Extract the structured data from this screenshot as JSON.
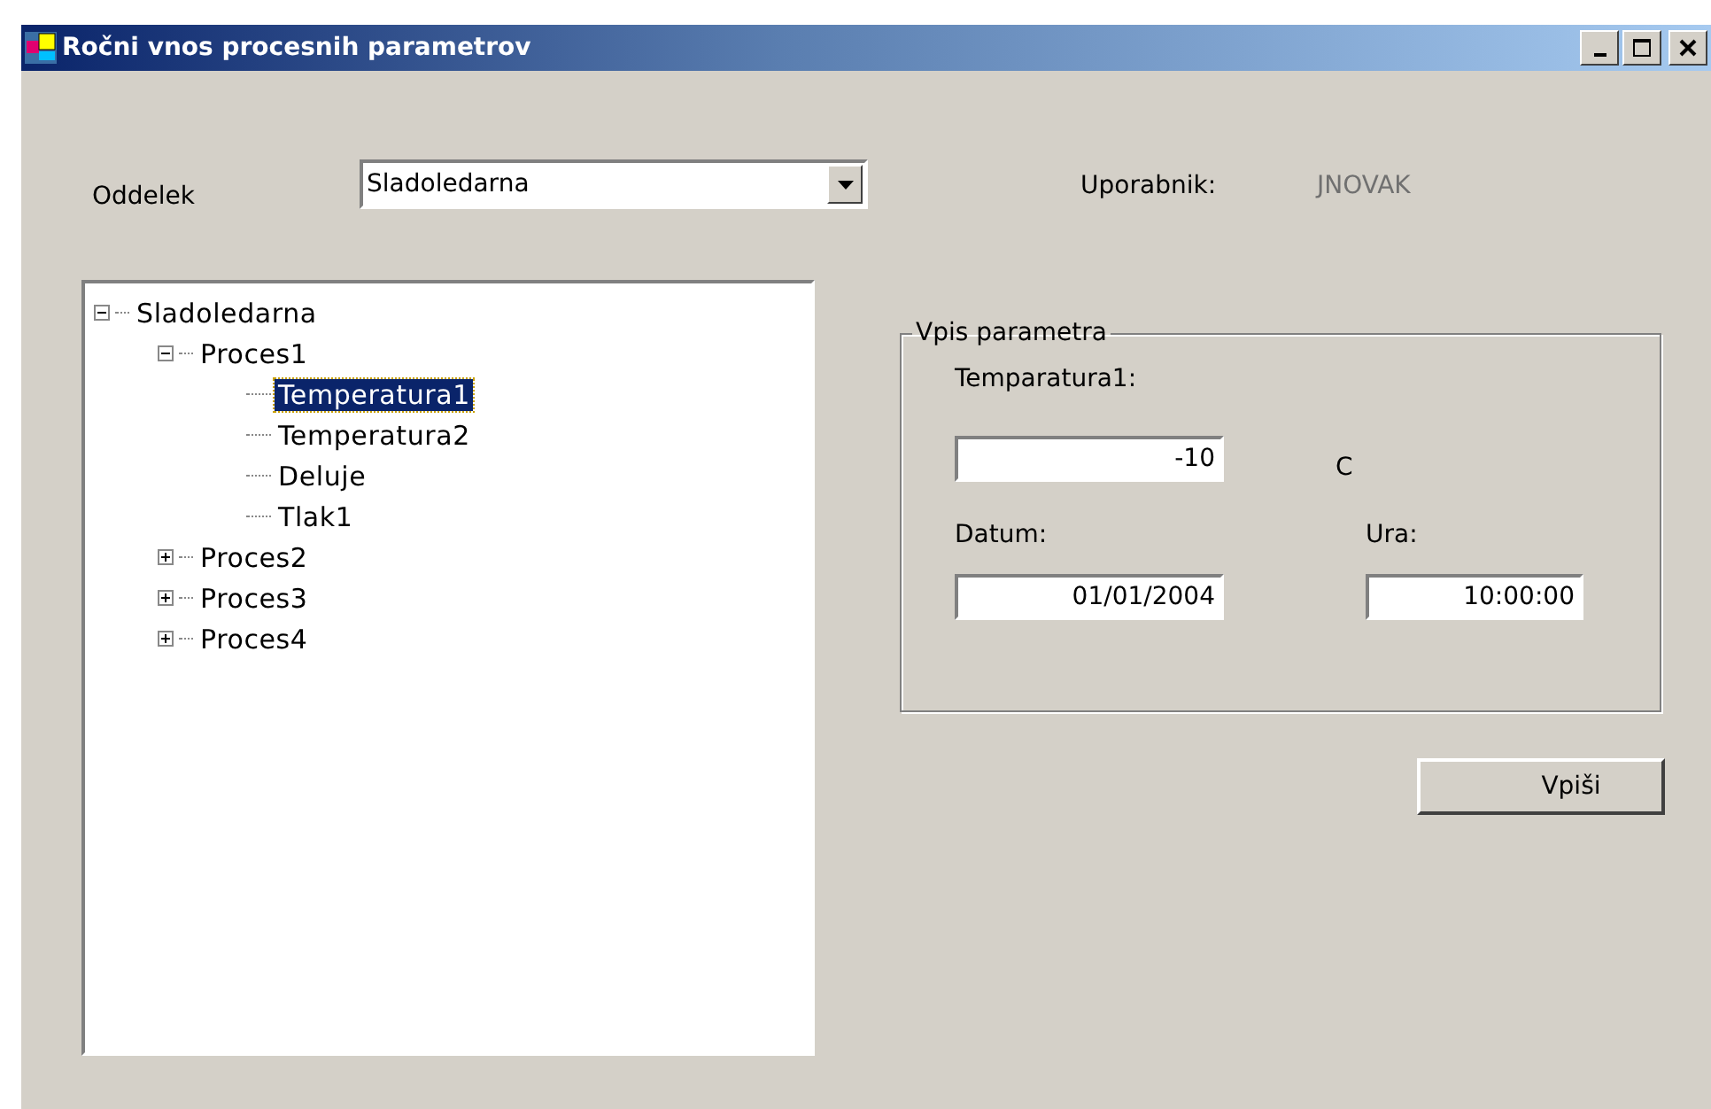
{
  "window": {
    "title": "Ročni vnos procesnih parametrov"
  },
  "department": {
    "label": "Oddelek",
    "value": "Sladoledarna"
  },
  "user": {
    "label": "Uporabnik:",
    "value": "JNOVAK"
  },
  "tree": [
    {
      "label": "Sladoledarna",
      "expanded": true,
      "selected": false,
      "children": [
        {
          "label": "Proces1",
          "expanded": true,
          "selected": false,
          "children": [
            {
              "label": "Temperatura1",
              "selected": true
            },
            {
              "label": "Temperatura2",
              "selected": false
            },
            {
              "label": "Deluje",
              "selected": false
            },
            {
              "label": "Tlak1",
              "selected": false
            }
          ]
        },
        {
          "label": "Proces2",
          "expanded": false,
          "selected": false
        },
        {
          "label": "Proces3",
          "expanded": false,
          "selected": false
        },
        {
          "label": "Proces4",
          "expanded": false,
          "selected": false
        }
      ]
    }
  ],
  "group": {
    "title": "Vpis parametra",
    "param_label": "Temparatura1:",
    "value": "-10",
    "unit": "C",
    "date_label": "Datum:",
    "date": "01/01/2004",
    "time_label": "Ura:",
    "time": "10:00:00"
  },
  "buttons": [
    "Vpiši"
  ]
}
